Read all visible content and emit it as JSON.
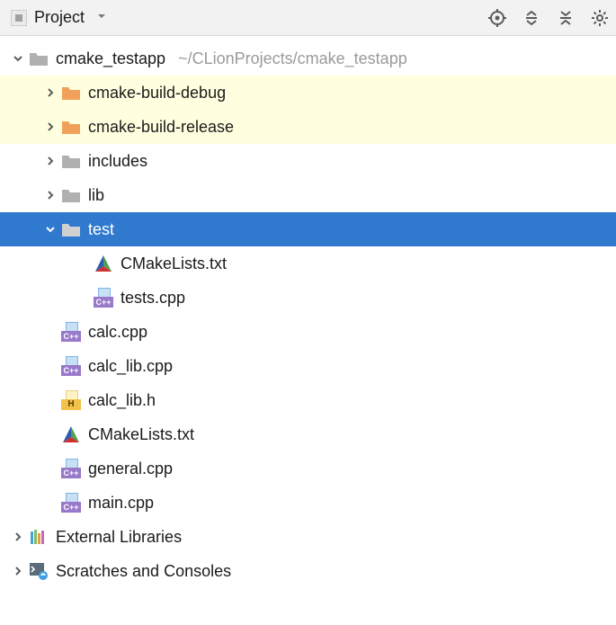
{
  "toolbar": {
    "project_label": "Project",
    "icons": {
      "target": "target-icon",
      "expand": "expand-all-icon",
      "collapse": "collapse-all-icon",
      "settings": "gear-icon"
    }
  },
  "tree": {
    "root": {
      "name": "cmake_testapp",
      "path": "~/CLionProjects/cmake_testapp"
    },
    "build_debug": "cmake-build-debug",
    "build_release": "cmake-build-release",
    "includes": "includes",
    "lib": "lib",
    "test": "test",
    "test_cmakelists": "CMakeLists.txt",
    "test_tests_cpp": "tests.cpp",
    "calc_cpp": "calc.cpp",
    "calc_lib_cpp": "calc_lib.cpp",
    "calc_lib_h": "calc_lib.h",
    "root_cmakelists": "CMakeLists.txt",
    "general_cpp": "general.cpp",
    "main_cpp": "main.cpp",
    "external_libs": "External Libraries",
    "scratches": "Scratches and Consoles"
  }
}
